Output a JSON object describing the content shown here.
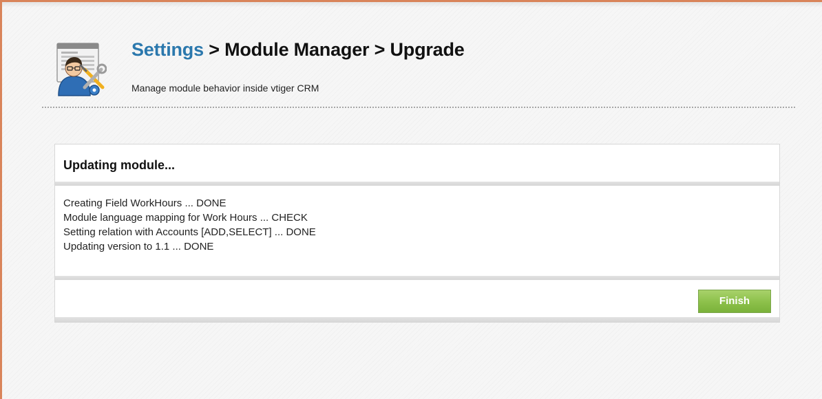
{
  "header": {
    "breadcrumb_settings": "Settings",
    "breadcrumb_rest": " > Module Manager > Upgrade",
    "subtitle": "Manage module behavior inside vtiger CRM",
    "icon": "settings-tools-user-icon"
  },
  "panel": {
    "title": "Updating module...",
    "log": [
      "Creating Field WorkHours ... DONE",
      "Module language mapping for Work Hours ... CHECK",
      "Setting relation with Accounts [ADD,SELECT] ... DONE",
      "Updating version to 1.1 ... DONE"
    ],
    "finish_label": "Finish"
  },
  "colors": {
    "link": "#2b78ad",
    "frame_border": "#d9845a",
    "button_green": "#8cc04a"
  }
}
